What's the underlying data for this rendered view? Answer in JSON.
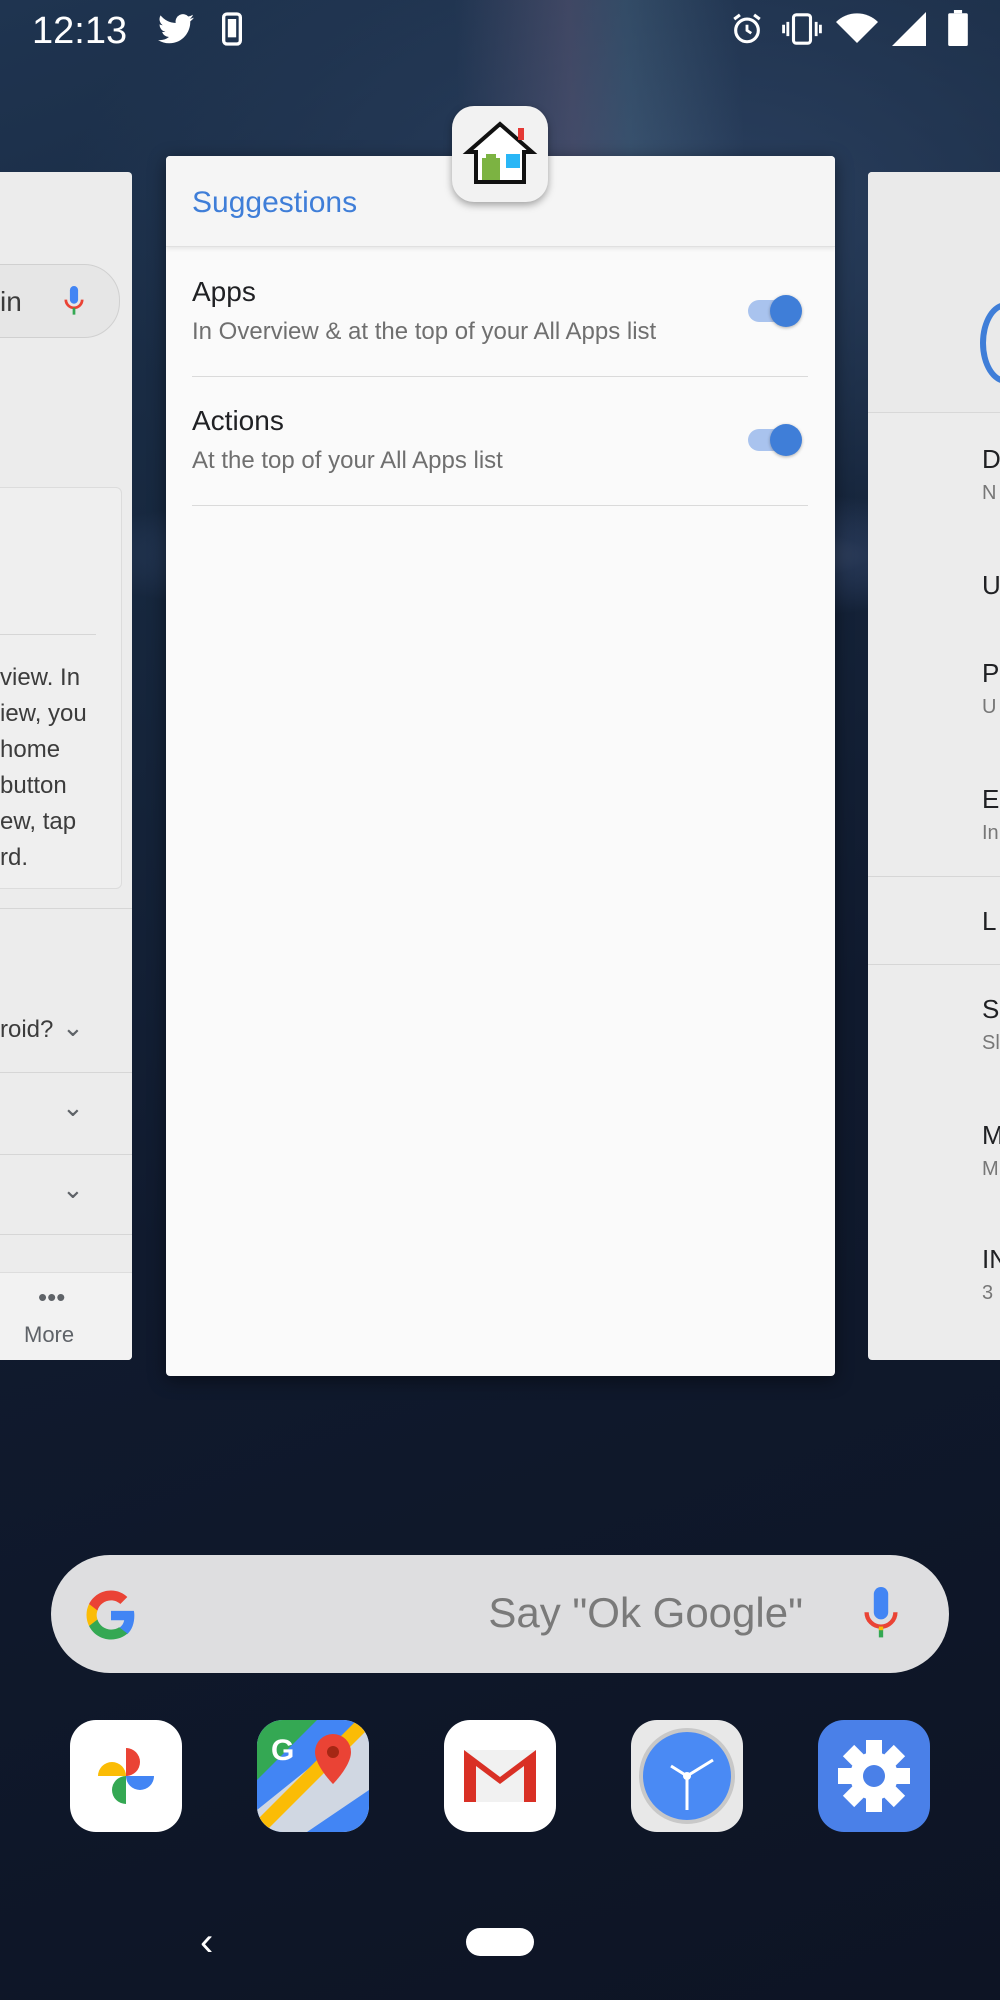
{
  "status_bar": {
    "time": "12:13",
    "icons": [
      "twitter-icon",
      "phone-icon",
      "alarm-icon",
      "vibrate-icon",
      "wifi-icon",
      "signal-icon",
      "battery-icon"
    ]
  },
  "main_card": {
    "title": "Suggestions",
    "settings": [
      {
        "title": "Apps",
        "subtitle": "In Overview & at the top of your All Apps list",
        "enabled": true
      },
      {
        "title": "Actions",
        "subtitle": "At the top of your All Apps list",
        "enabled": true
      }
    ],
    "accent_color": "#3f7ed8"
  },
  "left_card": {
    "search_fragment": "in",
    "paragraph_lines": [
      "view. In",
      "iew, you",
      "home",
      "button",
      "ew, tap",
      "rd."
    ],
    "faq_fragment": "roid?",
    "more_label": "More"
  },
  "right_card": {
    "letters": [
      "D",
      "N",
      "U",
      "P",
      "U",
      "E",
      "In",
      "L",
      "S",
      "Sl",
      "M",
      "M",
      "IN",
      "3"
    ]
  },
  "search_bar": {
    "placeholder": "Say \"Ok Google\""
  },
  "dock": {
    "apps": [
      "Photos",
      "Maps",
      "Gmail",
      "Clock",
      "Settings"
    ]
  }
}
